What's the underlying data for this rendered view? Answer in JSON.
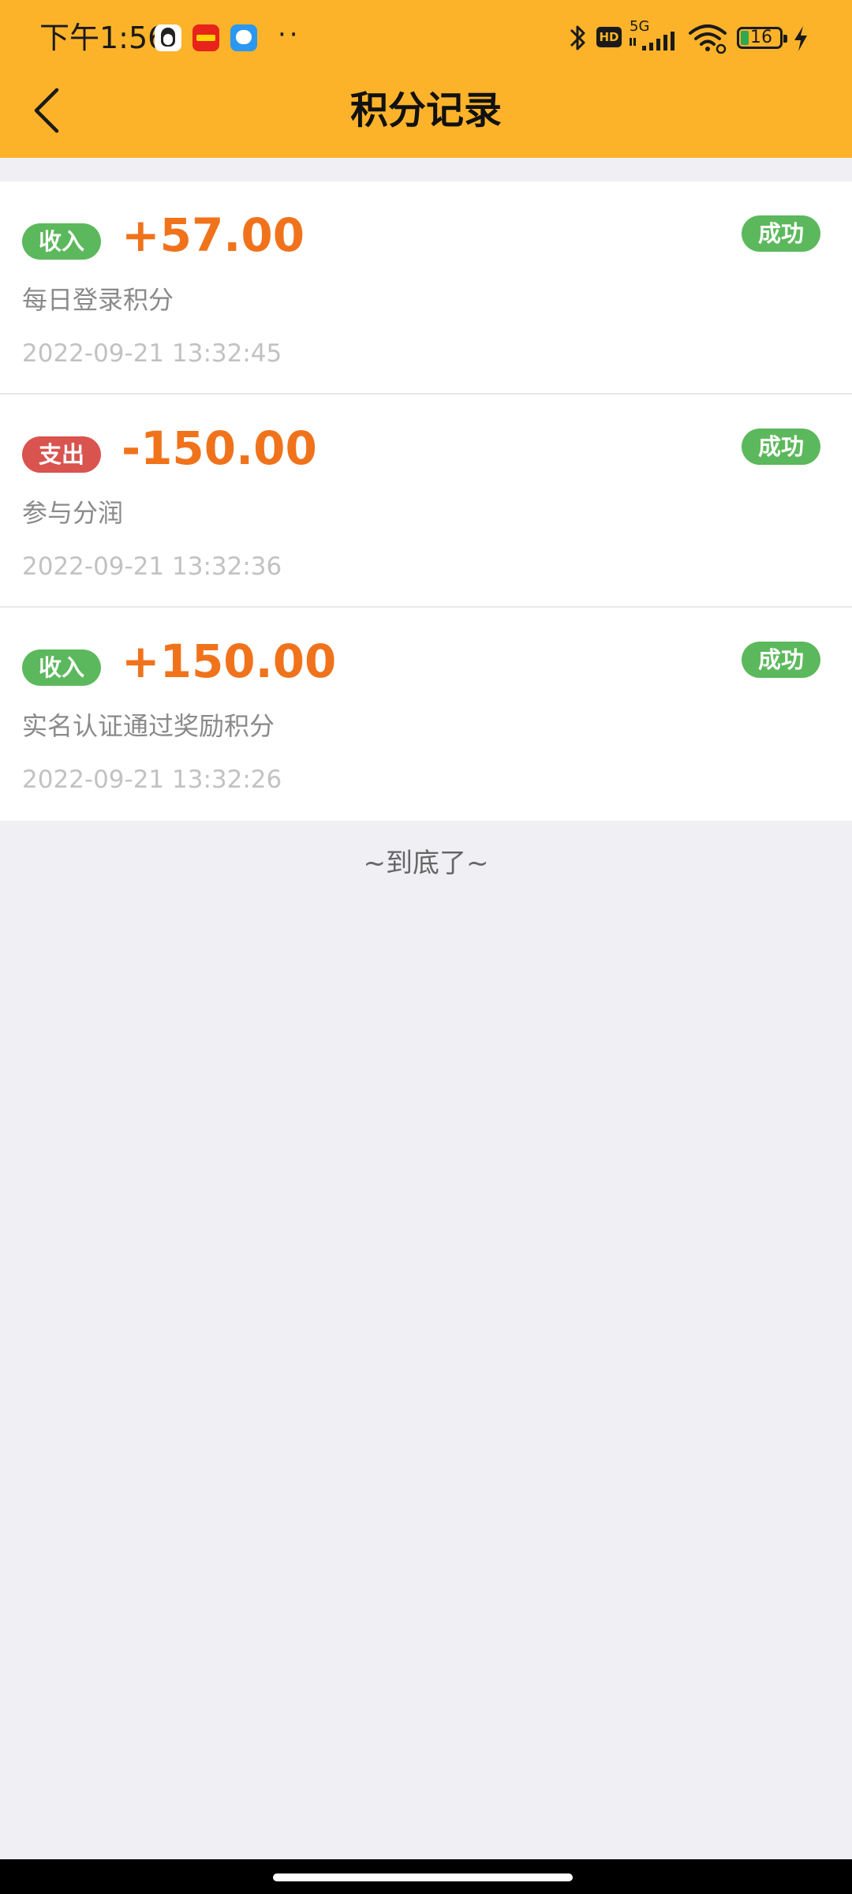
{
  "status_bar": {
    "time": "下午1:56",
    "more": "··",
    "network_label": "5G",
    "hd_label": "HD",
    "battery_level": "16"
  },
  "nav": {
    "title": "积分记录"
  },
  "records": [
    {
      "type_label": "收入",
      "type": "income",
      "amount": "+57.00",
      "status": "成功",
      "description": "每日登录积分",
      "time": "2022-09-21 13:32:45"
    },
    {
      "type_label": "支出",
      "type": "expense",
      "amount": "-150.00",
      "status": "成功",
      "description": "参与分润",
      "time": "2022-09-21 13:32:36"
    },
    {
      "type_label": "收入",
      "type": "income",
      "amount": "+150.00",
      "status": "成功",
      "description": "实名认证通过奖励积分",
      "time": "2022-09-21 13:32:26"
    }
  ],
  "footer": {
    "end_note": "~到底了~"
  },
  "colors": {
    "header": "#fcb32a",
    "amount": "#f0731c",
    "income_badge": "#5cb85c",
    "expense_badge": "#d9534f",
    "success_badge": "#5cb85c",
    "background": "#efeff4"
  }
}
